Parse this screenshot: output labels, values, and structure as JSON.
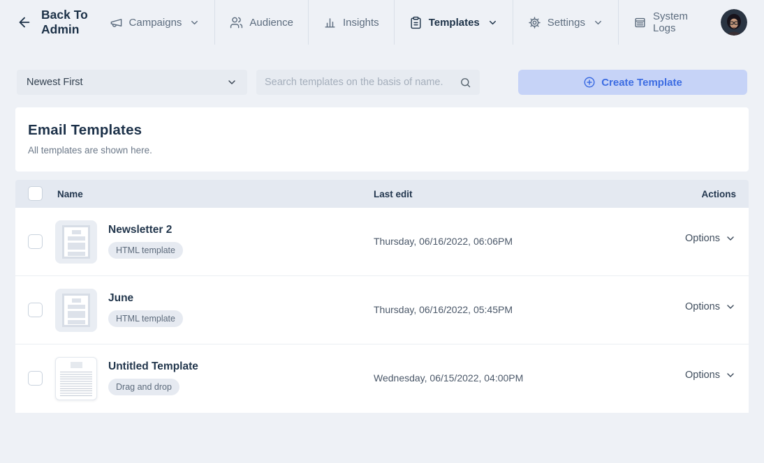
{
  "nav": {
    "back_label": "Back To Admin",
    "items": [
      {
        "label": "Campaigns",
        "icon": "megaphone-icon",
        "has_dropdown": true,
        "active": false
      },
      {
        "label": "Audience",
        "icon": "users-icon",
        "has_dropdown": false,
        "active": false
      },
      {
        "label": "Insights",
        "icon": "bar-chart-icon",
        "has_dropdown": false,
        "active": false
      },
      {
        "label": "Templates",
        "icon": "clipboard-icon",
        "has_dropdown": true,
        "active": true
      },
      {
        "label": "Settings",
        "icon": "gear-icon",
        "has_dropdown": true,
        "active": false
      },
      {
        "label": "System Logs",
        "icon": "logs-icon",
        "has_dropdown": false,
        "active": false
      }
    ]
  },
  "toolbar": {
    "sort_value": "Newest First",
    "search_placeholder": "Search templates on the basis of name.",
    "create_label": "Create Template"
  },
  "page_header": {
    "title": "Email Templates",
    "subtitle": "All templates are shown here."
  },
  "table": {
    "columns": [
      "Name",
      "Last edit",
      "Actions"
    ],
    "options_label": "Options",
    "rows": [
      {
        "name": "Newsletter 2",
        "type_badge": "HTML template",
        "last_edit": "Thursday, 06/16/2022, 06:06PM",
        "thumb": "html-document"
      },
      {
        "name": "June",
        "type_badge": "HTML template",
        "last_edit": "Thursday, 06/16/2022, 05:45PM",
        "thumb": "html-document"
      },
      {
        "name": "Untitled Template",
        "type_badge": "Drag and drop",
        "last_edit": "Wednesday, 06/15/2022, 04:00PM",
        "thumb": "drag-drop-preview"
      }
    ]
  },
  "colors": {
    "page_bg": "#eef1f6",
    "card_bg": "#ffffff",
    "table_header_bg": "#e4e9f1",
    "accent_blue": "#3c6ce2",
    "button_bg": "#c6d3f7",
    "navy_text": "#1c3147",
    "muted_text": "#5c6c7e"
  }
}
